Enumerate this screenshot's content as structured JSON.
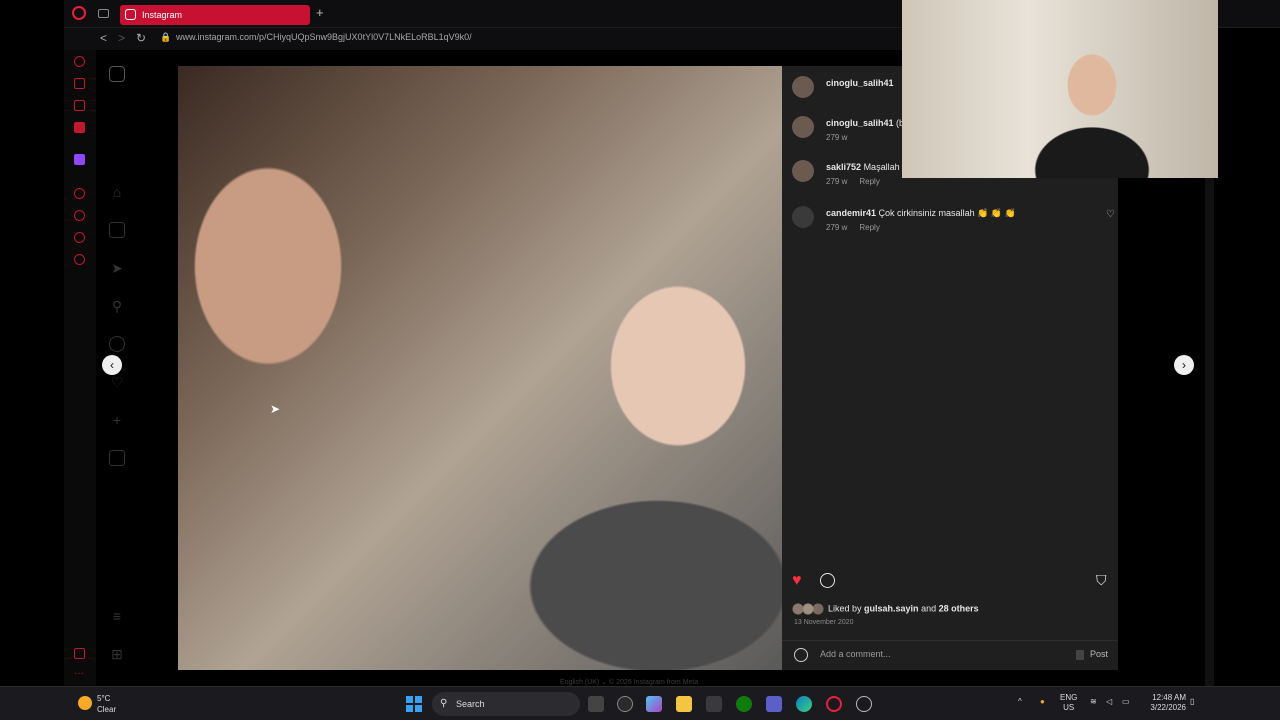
{
  "browser": {
    "tab_title": "Instagram",
    "new_tab": "+",
    "url": "www.instagram.com/p/CHiyqUQpSnw9BgjUX0tYl0V7LNkELoRBL1qV9k0/",
    "back": "<",
    "forward": ">",
    "reload": "↻"
  },
  "comments": [
    {
      "user": "cinoglu_salih41",
      "text": "",
      "time": "",
      "reply": ""
    },
    {
      "user": "cinoglu_salih41",
      "text": "(b",
      "time": "279 w",
      "reply": ""
    },
    {
      "user": "sakli752",
      "text": "Maşallah",
      "time": "279 w",
      "reply": "Reply"
    },
    {
      "user": "candemir41",
      "text": "Çok cirkinsiniz masallah 👏 👏 👏",
      "time": "279 w",
      "reply": "Reply"
    }
  ],
  "post": {
    "liked_by_prefix": "Liked by ",
    "liked_by_user": "gulsah.sayin",
    "liked_by_mid": " and ",
    "liked_by_others": "28 others",
    "date": "13 November 2020",
    "add_comment_placeholder": "Add a comment...",
    "post_label": "Post"
  },
  "footer": "English (UK) ⌄   © 2026 Instagram from Meta",
  "taskbar": {
    "temp": "5°C",
    "weather": "Clear",
    "search": "Search",
    "lang1": "ENG",
    "lang2": "US",
    "time": "12:48 AM",
    "date": "3/22/2026"
  },
  "colors": {
    "accent": "#c81032",
    "like": "#ff3040"
  },
  "icons": [
    "instagram-icon",
    "home-icon",
    "reels-icon",
    "send-icon",
    "search-icon",
    "explore-icon",
    "heart-icon",
    "plus-icon",
    "chart-icon",
    "menu-icon",
    "grid-icon"
  ]
}
